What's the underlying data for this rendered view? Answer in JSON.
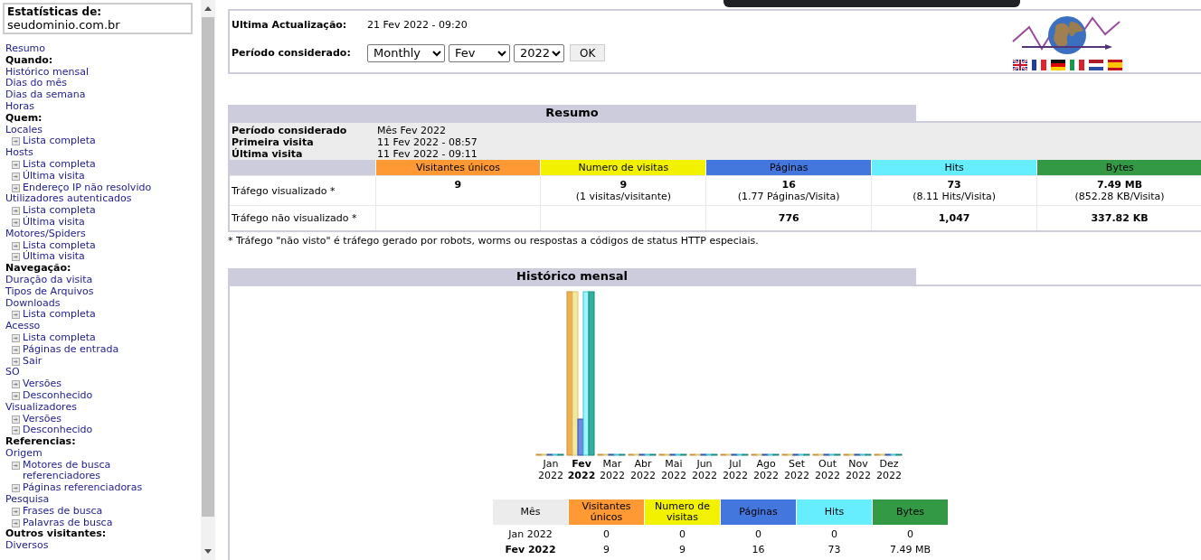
{
  "sidebar": {
    "title": "Estatísticas de:",
    "domain": "seudominio.com.br",
    "items": [
      {
        "kind": "link",
        "text": "Resumo"
      },
      {
        "kind": "heading",
        "text": "Quando:"
      },
      {
        "kind": "link",
        "text": "Histórico mensal"
      },
      {
        "kind": "link",
        "text": "Dias do mês"
      },
      {
        "kind": "link",
        "text": "Dias da semana"
      },
      {
        "kind": "link",
        "text": "Horas"
      },
      {
        "kind": "heading",
        "text": "Quem:"
      },
      {
        "kind": "link",
        "text": "Locales"
      },
      {
        "kind": "sublink",
        "text": "Lista completa"
      },
      {
        "kind": "link",
        "text": "Hosts"
      },
      {
        "kind": "sublink",
        "text": "Lista completa"
      },
      {
        "kind": "sublink",
        "text": "Última visita"
      },
      {
        "kind": "sublink",
        "text": "Endereço IP não resolvido"
      },
      {
        "kind": "link",
        "text": "Utilizadores autenticados"
      },
      {
        "kind": "sublink",
        "text": "Lista completa"
      },
      {
        "kind": "sublink",
        "text": "Última visita"
      },
      {
        "kind": "link",
        "text": "Motores/Spiders"
      },
      {
        "kind": "sublink",
        "text": "Lista completa"
      },
      {
        "kind": "sublink",
        "text": "Última visita"
      },
      {
        "kind": "heading",
        "text": "Navegação:"
      },
      {
        "kind": "link",
        "text": "Duração da visita"
      },
      {
        "kind": "link",
        "text": "Tipos de Arquivos"
      },
      {
        "kind": "link",
        "text": "Downloads"
      },
      {
        "kind": "sublink",
        "text": "Lista completa"
      },
      {
        "kind": "link",
        "text": "Acesso"
      },
      {
        "kind": "sublink",
        "text": "Lista completa"
      },
      {
        "kind": "sublink",
        "text": "Páginas de entrada"
      },
      {
        "kind": "sublink",
        "text": "Sair"
      },
      {
        "kind": "link",
        "text": "SO"
      },
      {
        "kind": "sublink",
        "text": "Versões"
      },
      {
        "kind": "sublink",
        "text": "Desconhecido"
      },
      {
        "kind": "link",
        "text": "Visualizadores"
      },
      {
        "kind": "sublink",
        "text": "Versões"
      },
      {
        "kind": "sublink",
        "text": "Desconhecido"
      },
      {
        "kind": "heading",
        "text": "Referencias:"
      },
      {
        "kind": "link",
        "text": "Origem"
      },
      {
        "kind": "sublink",
        "text": "Motores de busca referenciadores"
      },
      {
        "kind": "sublink",
        "text": "Páginas referenciadoras"
      },
      {
        "kind": "link",
        "text": "Pesquisa"
      },
      {
        "kind": "sublink",
        "text": "Frases de busca"
      },
      {
        "kind": "sublink",
        "text": "Palavras de busca"
      },
      {
        "kind": "heading",
        "text": "Outros visitantes:"
      },
      {
        "kind": "link",
        "text": "Diversos"
      }
    ]
  },
  "header": {
    "update_label": "Ultima Actualização:",
    "update_value": "21 Fev 2022 - 09:20",
    "period_label": "Período considerado:",
    "selects": [
      "Monthly",
      "Fev",
      "2022"
    ],
    "ok_button": "OK"
  },
  "summary": {
    "title": "Resumo",
    "info": [
      {
        "label": "Período considerado",
        "value": "Mês Fev 2022"
      },
      {
        "label": "Primeira visita",
        "value": "11 Fev 2022 - 08:57"
      },
      {
        "label": "Última visita",
        "value": "11 Fev 2022 - 09:11"
      }
    ],
    "columns": [
      {
        "label": "Visitantes únicos",
        "color": "#ff9933"
      },
      {
        "label": "Numero de visitas",
        "color": "#f2f200"
      },
      {
        "label": "Páginas",
        "color": "#4477dd"
      },
      {
        "label": "Hits",
        "color": "#66eeff"
      },
      {
        "label": "Bytes",
        "color": "#339944"
      }
    ],
    "rows": [
      {
        "label": "Tráfego visualizado *",
        "cells": [
          {
            "value": "9"
          },
          {
            "value": "9",
            "note": "(1 visitas/visitante)"
          },
          {
            "value": "16",
            "note": "(1.77 Páginas/Visita)"
          },
          {
            "value": "73",
            "note": "(8.11 Hits/Visita)"
          },
          {
            "value": "7.49 MB",
            "note": "(852.28 KB/Visita)"
          }
        ]
      },
      {
        "label": "Tráfego não visualizado *",
        "cells": [
          {},
          {},
          {
            "value": "776"
          },
          {
            "value": "1,047"
          },
          {
            "value": "337.82 KB"
          }
        ]
      }
    ],
    "footnote": "* Tráfego \"não visto\" é tráfego gerado por robots, worms ou respostas a códigos de status HTTP especiais."
  },
  "history": {
    "title": "Histórico mensal",
    "months": [
      {
        "month": "Jan",
        "year": "2022",
        "selected": false
      },
      {
        "month": "Fev",
        "year": "2022",
        "selected": true
      },
      {
        "month": "Mar",
        "year": "2022",
        "selected": false
      },
      {
        "month": "Abr",
        "year": "2022",
        "selected": false
      },
      {
        "month": "Mai",
        "year": "2022",
        "selected": false
      },
      {
        "month": "Jun",
        "year": "2022",
        "selected": false
      },
      {
        "month": "Jul",
        "year": "2022",
        "selected": false
      },
      {
        "month": "Ago",
        "year": "2022",
        "selected": false
      },
      {
        "month": "Set",
        "year": "2022",
        "selected": false
      },
      {
        "month": "Out",
        "year": "2022",
        "selected": false
      },
      {
        "month": "Nov",
        "year": "2022",
        "selected": false
      },
      {
        "month": "Dez",
        "year": "2022",
        "selected": false
      }
    ],
    "columns": [
      {
        "label": "Mês",
        "color": "#ececec"
      },
      {
        "label": "Visitantes únicos",
        "color": "#ff9933"
      },
      {
        "label": "Numero de visitas",
        "color": "#f2f200"
      },
      {
        "label": "Páginas",
        "color": "#4477dd"
      },
      {
        "label": "Hits",
        "color": "#66eeff"
      },
      {
        "label": "Bytes",
        "color": "#339944"
      }
    ],
    "rows": [
      {
        "month": "Jan 2022",
        "selected": false,
        "values": [
          "0",
          "0",
          "0",
          "0",
          "0"
        ]
      },
      {
        "month": "Fev 2022",
        "selected": true,
        "values": [
          "9",
          "9",
          "16",
          "73",
          "7.49 MB"
        ]
      }
    ]
  }
}
